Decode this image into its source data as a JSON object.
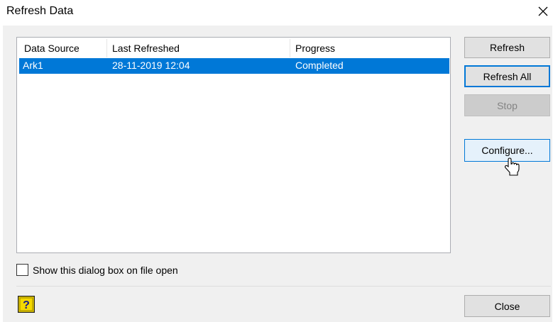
{
  "window": {
    "title": "Refresh Data"
  },
  "list": {
    "columns": [
      "Data Source",
      "Last Refreshed",
      "Progress"
    ],
    "rows": [
      {
        "data_source": "Ark1",
        "last_refreshed": "28-11-2019 12:04",
        "progress": "Completed",
        "selected": true
      }
    ]
  },
  "buttons": {
    "refresh": "Refresh",
    "refresh_all": "Refresh All",
    "stop": "Stop",
    "configure": "Configure...",
    "close": "Close"
  },
  "options": {
    "show_on_open_label": "Show this dialog box on file open",
    "show_on_open_checked": false
  },
  "colors": {
    "selection": "#0078d7",
    "dialog_bg": "#f0f0f0",
    "button_bg": "#e1e1e1",
    "button_disabled_bg": "#cccccc",
    "help_icon": "#f5d900"
  },
  "icons": {
    "close": "close-icon",
    "help": "help-icon",
    "cursor": "mouse-pointer-icon"
  }
}
